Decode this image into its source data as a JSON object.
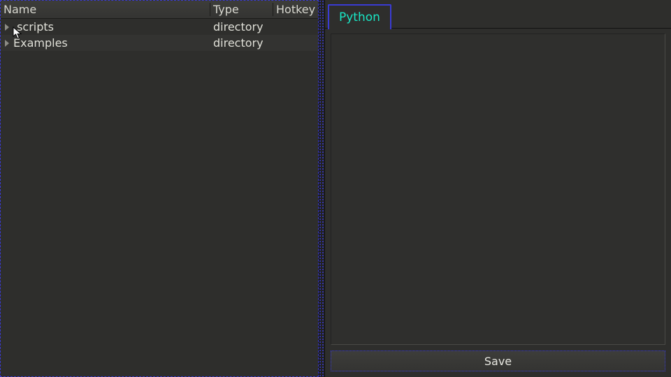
{
  "tree": {
    "columns": {
      "name": "Name",
      "type": "Type",
      "hotkey": "Hotkey"
    },
    "rows": [
      {
        "name": ".scripts",
        "type": "directory",
        "hotkey": ""
      },
      {
        "name": "Examples",
        "type": "directory",
        "hotkey": ""
      }
    ]
  },
  "tabs": {
    "active": "Python"
  },
  "editor": {
    "content": ""
  },
  "actions": {
    "save": "Save"
  }
}
